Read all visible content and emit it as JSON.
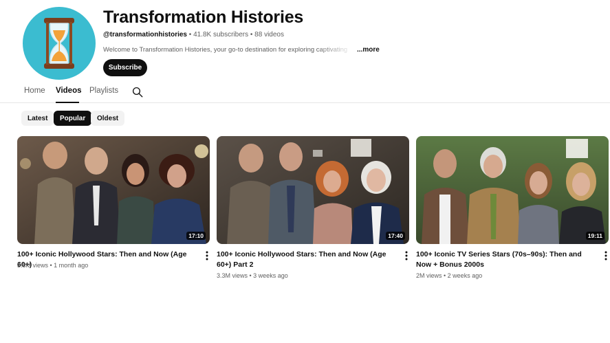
{
  "channel": {
    "title": "Transformation Histories",
    "handle": "@transformationhistories",
    "subscribers": "41.8K subscribers",
    "videos_count": "88 videos",
    "description": "Welcome to Transformation Histories, your go-to destination for exploring captivating",
    "more_label": "...more",
    "subscribe_label": "Subscribe"
  },
  "tabs": [
    {
      "label": "Home"
    },
    {
      "label": "Videos"
    },
    {
      "label": "Playlists"
    }
  ],
  "chips": [
    {
      "label": "Latest"
    },
    {
      "label": "Popular"
    },
    {
      "label": "Oldest"
    }
  ],
  "videos": [
    {
      "title": "100+ Iconic Hollywood Stars: Then and Now (Age 60+)",
      "views": "3.8M views",
      "age": "1 month ago",
      "duration": "17:10"
    },
    {
      "title": "100+ Iconic Hollywood Stars: Then and Now (Age 60+) Part 2",
      "views": "3.3M views",
      "age": "3 weeks ago",
      "duration": "17:40"
    },
    {
      "title": "100+ Iconic TV Series Stars (70s–90s): Then and Now + Bonus 2000s",
      "views": "2M views",
      "age": "2 weeks ago",
      "duration": "19:11"
    }
  ],
  "icons": {
    "avatar": "hourglass-icon",
    "search": "search-icon",
    "menu": "more-vertical-icon"
  },
  "colors": {
    "avatar_bg": "#3bbcd0",
    "primary_text": "#0f0f0f",
    "secondary_text": "#606060",
    "chip_bg": "#f2f2f2"
  }
}
